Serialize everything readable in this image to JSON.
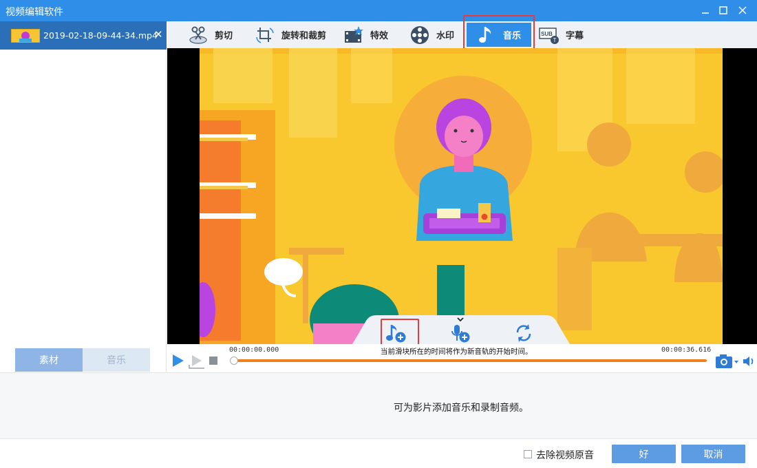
{
  "window": {
    "title": "视频编辑软件"
  },
  "file": {
    "name": "2019-02-18-09-44-34.mp4"
  },
  "toolbar": {
    "tools": [
      {
        "label": "剪切",
        "icon": "scissors-icon"
      },
      {
        "label": "旋转和裁剪",
        "icon": "rotate-crop-icon"
      },
      {
        "label": "特效",
        "icon": "effects-icon"
      },
      {
        "label": "水印",
        "icon": "watermark-icon"
      },
      {
        "label": "音乐",
        "icon": "music-note-icon",
        "active": true
      },
      {
        "label": "字幕",
        "icon": "subtitle-icon"
      }
    ]
  },
  "library": {
    "tabs": [
      "素材",
      "音乐"
    ],
    "active": "素材"
  },
  "player": {
    "time_start": "00:00:00.000",
    "time_end": "00:00:36.616",
    "hint": "当前滑块所在的时间将作为新音轨的开始时间。",
    "progress_fraction": 0
  },
  "music_controls": [
    {
      "icon": "add-music-icon"
    },
    {
      "icon": "record-audio-icon"
    },
    {
      "icon": "replace-audio-icon"
    }
  ],
  "info": {
    "text": "可为影片添加音乐和录制音频。"
  },
  "footer": {
    "mute_original_label": "去除视频原音",
    "mute_original_checked": false,
    "ok_label": "好",
    "cancel_label": "取消"
  },
  "colors": {
    "accent": "#2f8fe8",
    "file_tab": "#2b6fb8",
    "highlight_box": "#e83a3a",
    "progress": "#ef8020",
    "button": "#5d9be3"
  }
}
